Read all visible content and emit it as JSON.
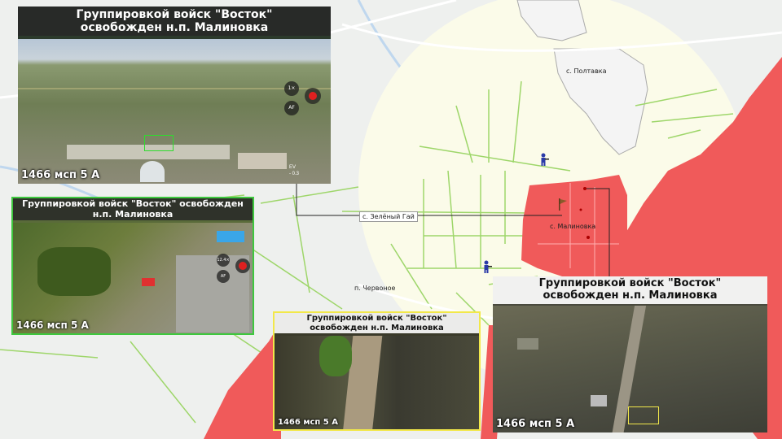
{
  "map": {
    "places": {
      "poltavka": "с. Полтавка",
      "zeleny_gai": "с. Зелёный Гай",
      "malinovka": "с. Малиновка",
      "chervonoe": "п. Червоное"
    },
    "colors": {
      "enemy_zone": "#f05a5a",
      "highlight_zone": "#fbfbe9",
      "roads": "#9ed66a",
      "background": "#eef0ee",
      "river": "#bfd7ee"
    }
  },
  "panels": {
    "p1": {
      "title": "Группировкой войск \"Восток\" освобожден н.п. Малиновка",
      "caption": "1466 мсп 5 А",
      "camera_ui": {
        "zoom": "1×",
        "focus": "AF",
        "ev_label": "EV",
        "ev_value": "- 0.3"
      },
      "border_color": "#555555"
    },
    "p2": {
      "title": "Группировкой войск \"Восток\" освобожден н.п. Малиновка",
      "caption": "1466 мсп 5 А",
      "camera_ui": {
        "zoom": "12.4×",
        "focus": "AF"
      },
      "border_color": "#3ec83e"
    },
    "p3": {
      "title": "Группировкой войск \"Восток\" освобожден н.п. Малиновка",
      "caption": "1466 мсп 5 А",
      "border_color": "#f2e84a"
    },
    "p4": {
      "title": "Группировкой войск \"Восток\" освобожден н.п. Малиновка",
      "caption": "1466 мсп 5 А",
      "border_color": "#555555"
    }
  }
}
